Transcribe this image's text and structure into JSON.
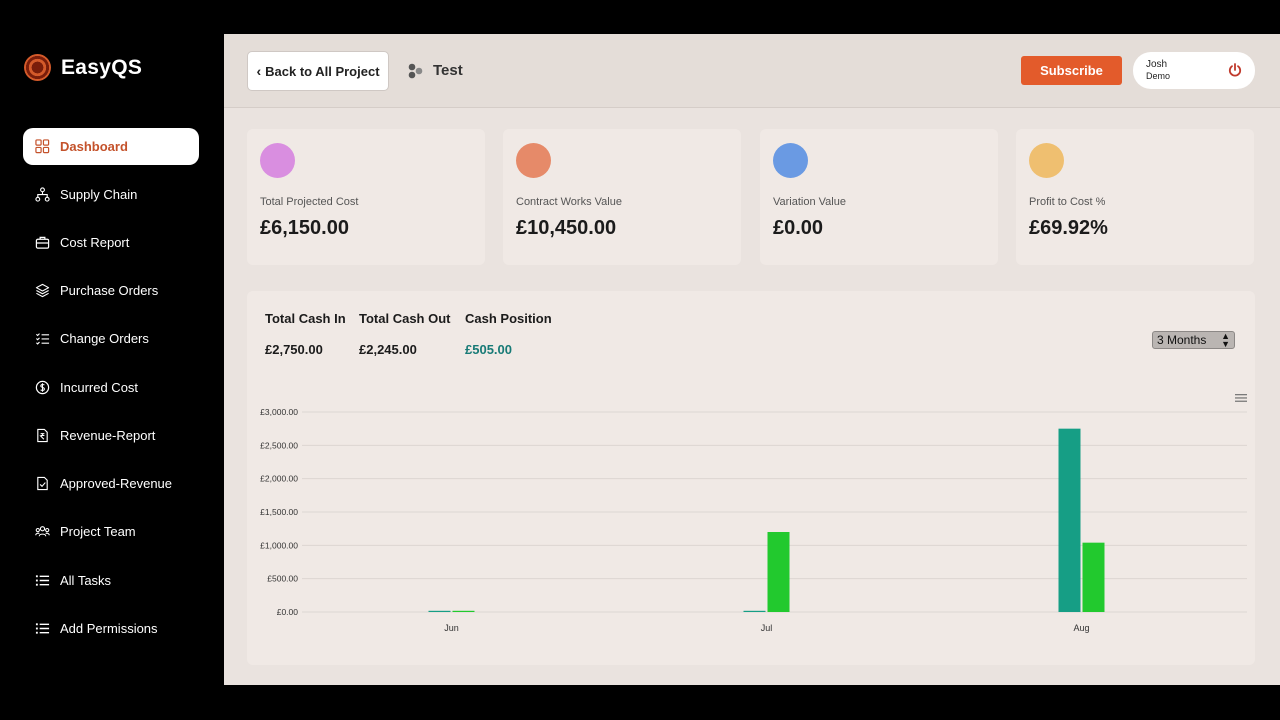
{
  "brand": {
    "name": "EasyQS"
  },
  "sidebar": {
    "items": [
      {
        "label": "Dashboard",
        "icon": "grid-icon",
        "active": true
      },
      {
        "label": "Supply Chain",
        "icon": "hierarchy-icon"
      },
      {
        "label": "Cost Report",
        "icon": "briefcase-icon"
      },
      {
        "label": "Purchase Orders",
        "icon": "layers-icon"
      },
      {
        "label": "Change Orders",
        "icon": "checklist-icon"
      },
      {
        "label": "Incurred Cost",
        "icon": "dollar-circle-icon"
      },
      {
        "label": "Revenue-Report",
        "icon": "rupee-doc-icon"
      },
      {
        "label": "Approved-Revenue",
        "icon": "check-doc-icon"
      },
      {
        "label": "Project Team",
        "icon": "team-icon"
      },
      {
        "label": "All Tasks",
        "icon": "list-icon"
      },
      {
        "label": "Add Permissions",
        "icon": "list-icon"
      }
    ]
  },
  "header": {
    "back_label": "Back to All Project",
    "project_title": "Test",
    "subscribe_label": "Subscribe",
    "user_name": "Josh",
    "user_role": "Demo"
  },
  "cards": [
    {
      "label": "Total Projected Cost",
      "value": "£6,150.00",
      "color": "#d98ee0"
    },
    {
      "label": "Contract Works Value",
      "value": "£10,450.00",
      "color": "#e68a69"
    },
    {
      "label": "Variation Value",
      "value": "£0.00",
      "color": "#6a9ae3"
    },
    {
      "label": "Profit to Cost %",
      "value": "£69.92%",
      "color": "#efbf70"
    }
  ],
  "cash": {
    "in_label": "Total Cash In",
    "in_value": "£2,750.00",
    "out_label": "Total Cash Out",
    "out_value": "£2,245.00",
    "pos_label": "Cash Position",
    "pos_value": "£505.00",
    "period": "3 Months"
  },
  "chart_data": {
    "type": "bar",
    "categories": [
      "Jun",
      "Jul",
      "Aug"
    ],
    "series": [
      {
        "values": [
          0,
          0,
          2750
        ],
        "color": "#169e85"
      },
      {
        "values": [
          0,
          1200,
          1040
        ],
        "color": "#22c92e"
      }
    ],
    "ylim": [
      0,
      3000
    ],
    "yticks": [
      "£0.00",
      "£500.00",
      "£1,000.00",
      "£1,500.00",
      "£2,000.00",
      "£2,500.00",
      "£3,000.00"
    ],
    "grid": true
  }
}
